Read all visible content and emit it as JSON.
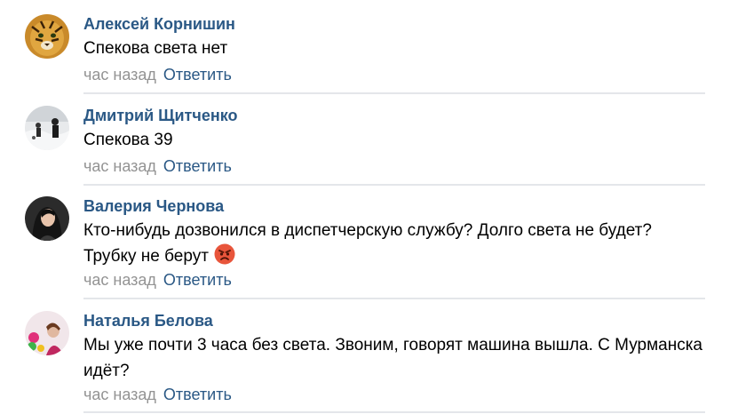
{
  "comments": [
    {
      "author": "Алексей Корнишин",
      "text": "Спекова света нет",
      "time": "час назад",
      "reply": "Ответить",
      "avatar_icon": "tiger-avatar"
    },
    {
      "author": "Дмитрий Щитченко",
      "text": "Спекова 39",
      "time": "час назад",
      "reply": "Ответить",
      "avatar_icon": "snow-scene-avatar"
    },
    {
      "author": "Валерия Чернова",
      "text": "Кто-нибудь дозвонился в диспетчерскую службу? Долго света не будет? Трубку не берут",
      "time": "час назад",
      "reply": "Ответить",
      "avatar_icon": "woman-portrait-avatar",
      "emoji": "angry-face-icon"
    },
    {
      "author": "Наталья Белова",
      "text": "Мы уже почти 3 часа без света. Звоним, говорят машина вышла. С Мурманска идёт?",
      "time": "час назад",
      "reply": "Ответить",
      "avatar_icon": "woman-flowers-avatar"
    }
  ],
  "colors": {
    "author": "#2a5885",
    "link": "#2a5885",
    "time": "#939393",
    "divider": "#e4e6ea",
    "text": "#000000"
  }
}
